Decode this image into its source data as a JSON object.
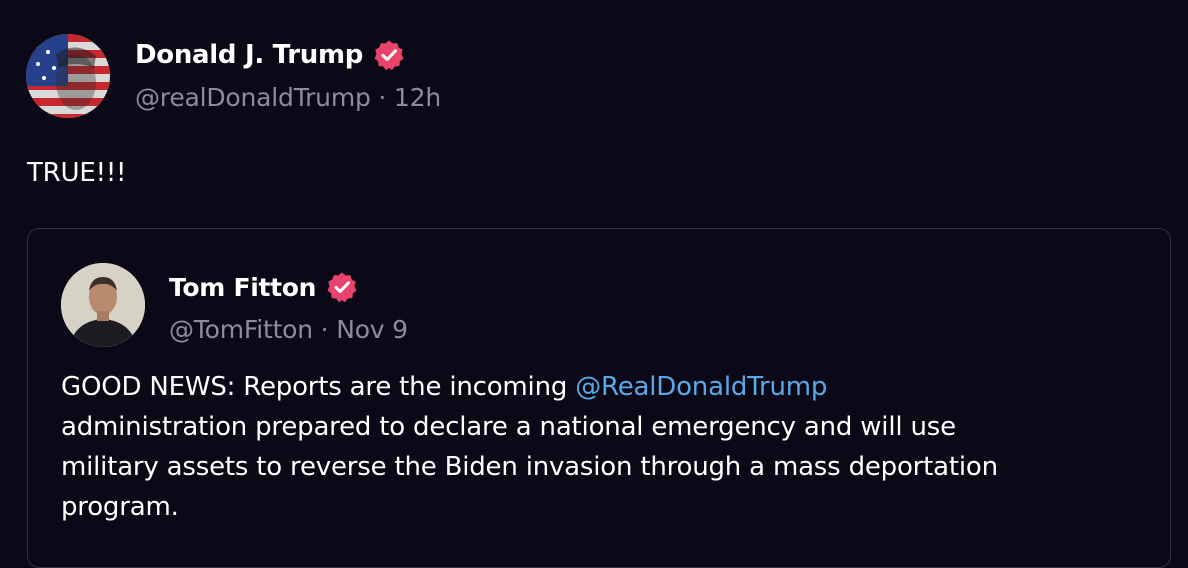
{
  "post": {
    "author_name": "Donald J. Trump",
    "handle": "@realDonaldTrump",
    "separator": " · ",
    "time": "12h",
    "text": "TRUE!!!"
  },
  "quote": {
    "author_name": "Tom Fitton",
    "handle": "@TomFitton",
    "separator": " · ",
    "date": "Nov 9",
    "text_before_mention": "GOOD NEWS: Reports are the incoming ",
    "mention": "@RealDonaldTrump",
    "line2": " administration prepared to declare a national emergency and will use",
    "line3": "military assets to reverse the Biden invasion through a mass deportation",
    "line4": "program."
  },
  "colors": {
    "background": "#0b0817",
    "verified_badge": "#e8436a",
    "mention": "#5aa9e6",
    "muted_text": "#8e8b9b"
  },
  "icons": {
    "verified": "verified-badge-icon"
  }
}
